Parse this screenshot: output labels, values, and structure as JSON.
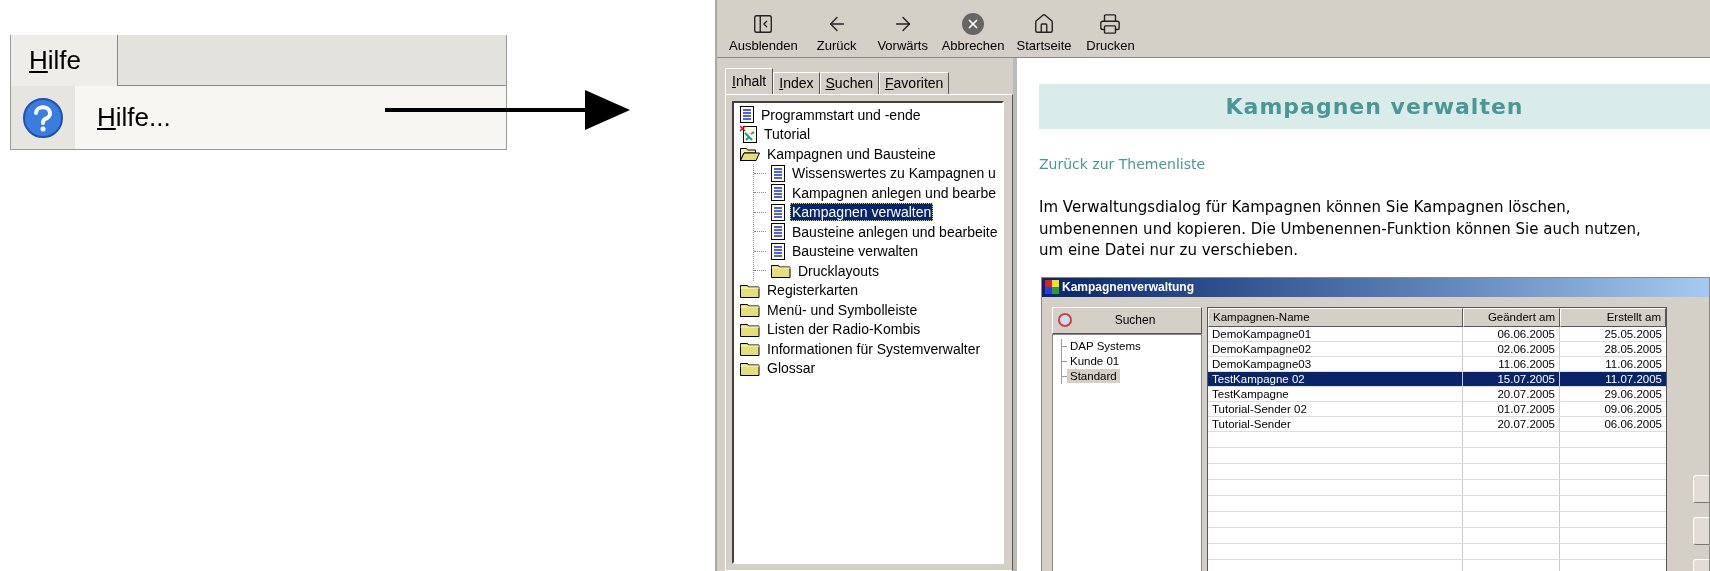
{
  "menu_snippet": {
    "menu_title": "Hilfe",
    "items": [
      {
        "label": "Hilfe..."
      }
    ]
  },
  "help_window": {
    "toolbar": [
      {
        "label": "Ausblenden",
        "kind": "hide"
      },
      {
        "label": "Zurück",
        "kind": "back"
      },
      {
        "label": "Vorwärts",
        "kind": "forward"
      },
      {
        "label": "Abbrechen",
        "kind": "stop"
      },
      {
        "label": "Startseite",
        "kind": "home"
      },
      {
        "label": "Drucken",
        "kind": "print"
      }
    ],
    "nav_tabs": [
      {
        "label": "Inhalt",
        "selected": true
      },
      {
        "label": "Index",
        "selected": false
      },
      {
        "label": "Suchen",
        "selected": false
      },
      {
        "label": "Favoriten",
        "selected": false
      }
    ],
    "contents_tree": [
      {
        "label": "Programmstart und -ende",
        "kind": "page",
        "selected": false
      },
      {
        "label": "Tutorial",
        "kind": "tutorial",
        "selected": false
      },
      {
        "label": "Kampagnen und Bausteine",
        "kind": "folder",
        "expanded": true,
        "selected": false,
        "children": [
          {
            "label": "Wissenswertes zu Kampagnen u",
            "kind": "page",
            "selected": false
          },
          {
            "label": "Kampagnen anlegen und bearbe",
            "kind": "page",
            "selected": false
          },
          {
            "label": "Kampagnen verwalten",
            "kind": "page",
            "selected": true
          },
          {
            "label": "Bausteine anlegen und bearbeite",
            "kind": "page",
            "selected": false
          },
          {
            "label": "Bausteine verwalten",
            "kind": "page",
            "selected": false
          },
          {
            "label": "Drucklayouts",
            "kind": "folder",
            "expanded": false,
            "selected": false
          }
        ]
      },
      {
        "label": "Registerkarten",
        "kind": "folder",
        "expanded": false,
        "selected": false
      },
      {
        "label": "Menü- und Symbolleiste",
        "kind": "folder",
        "expanded": false,
        "selected": false
      },
      {
        "label": "Listen der Radio-Kombis",
        "kind": "folder",
        "expanded": false,
        "selected": false
      },
      {
        "label": "Informationen für Systemverwalter",
        "kind": "folder",
        "expanded": false,
        "selected": false
      },
      {
        "label": "Glossar",
        "kind": "folder",
        "expanded": false,
        "selected": false
      }
    ],
    "topic": {
      "title": "Kampagnen verwalten",
      "back_link": "Zurück zur Themenliste",
      "paragraph": "Im Verwaltungsdialog für Kampagnen können Sie Kampagnen löschen, umbenennen und kopieren. Die Umbenennen-Funktion können Sie auch nutzen, um eine Datei nur zu verschieben.",
      "screenshot": {
        "title": "Kampagnenverwaltung",
        "search_button": "Suchen",
        "tree": [
          {
            "label": "DAP Systems",
            "selected": false
          },
          {
            "label": "Kunde 01",
            "selected": false
          },
          {
            "label": "Standard",
            "selected": true
          }
        ],
        "table": {
          "columns": [
            "Kampagnen-Name",
            "Geändert am",
            "Erstellt am"
          ],
          "rows": [
            {
              "cells": [
                "DemoKampagne01",
                "06.06.2005",
                "25.05.2005"
              ],
              "selected": false
            },
            {
              "cells": [
                "DemoKampagne02",
                "02.06.2005",
                "28.05.2005"
              ],
              "selected": false
            },
            {
              "cells": [
                "DemoKampagne03",
                "11.06.2005",
                "11.06.2005"
              ],
              "selected": false
            },
            {
              "cells": [
                "TestKampagne 02",
                "15.07.2005",
                "11.07.2005"
              ],
              "selected": true
            },
            {
              "cells": [
                "TestKampagne",
                "20.07.2005",
                "29.06.2005"
              ],
              "selected": false
            },
            {
              "cells": [
                "Tutorial-Sender 02",
                "01.07.2005",
                "09.06.2005"
              ],
              "selected": false
            },
            {
              "cells": [
                "Tutorial-Sender",
                "20.07.2005",
                "06.06.2005"
              ],
              "selected": false
            }
          ]
        }
      }
    }
  }
}
